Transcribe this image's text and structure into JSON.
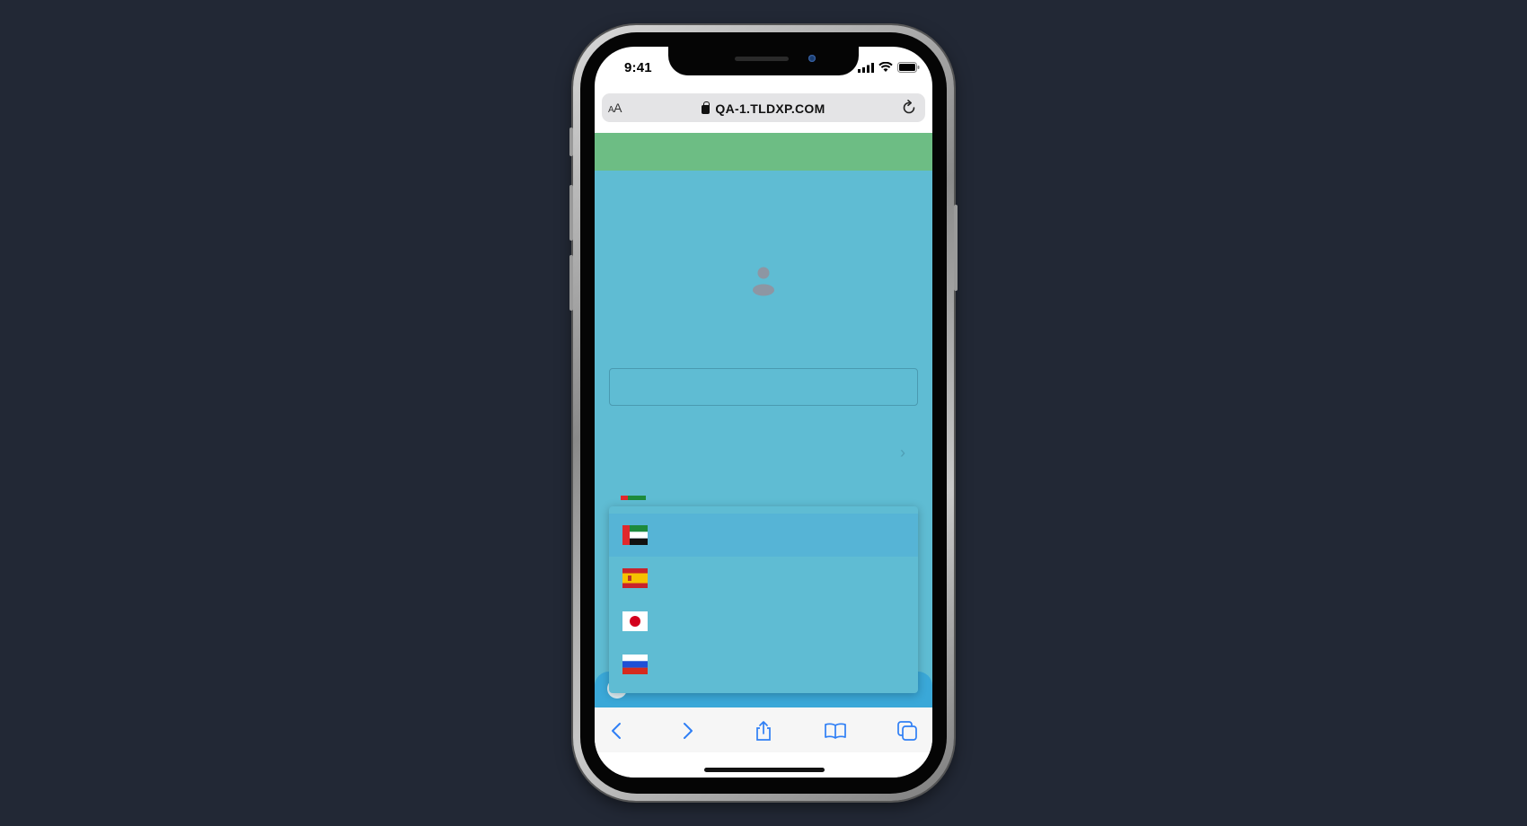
{
  "status_bar": {
    "time": "9:41"
  },
  "browser": {
    "text_size_button": "AA",
    "url": "QA-1.TLDXP.COM"
  },
  "page": {
    "background_color": "#5fbcd3",
    "banner_color": "#6dbd84"
  },
  "language_dropdown": {
    "items": [
      {
        "flag": "uae-flag-icon",
        "label": "",
        "active": true
      },
      {
        "flag": "spain-flag-icon",
        "label": "",
        "active": false
      },
      {
        "flag": "japan-flag-icon",
        "label": "",
        "active": false
      },
      {
        "flag": "russia-flag-icon",
        "label": "",
        "active": false
      }
    ]
  },
  "toolbar": {
    "buttons": [
      "back-icon",
      "forward-icon",
      "share-icon",
      "bookmarks-icon",
      "tabs-icon"
    ],
    "accent_color": "#2f7ff5"
  }
}
